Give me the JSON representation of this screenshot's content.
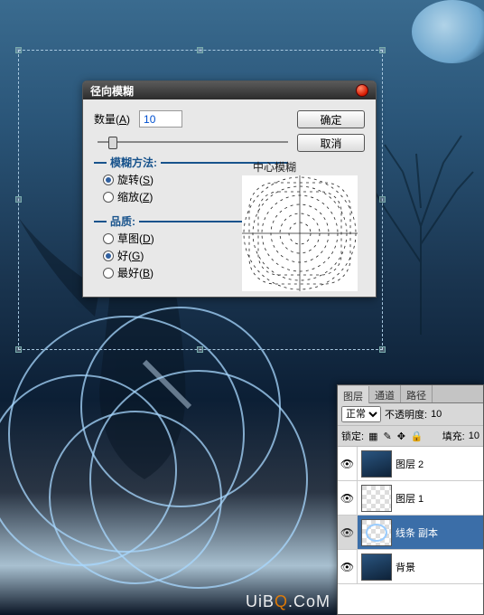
{
  "dialog": {
    "title": "径向模糊",
    "amount_label": "数量",
    "amount_key": "A",
    "amount_value": "10",
    "ok": "确定",
    "cancel": "取消",
    "method_group": "模糊方法:",
    "radio_spin": "旋转",
    "radio_spin_key": "S",
    "radio_zoom": "缩放",
    "radio_zoom_key": "Z",
    "quality_group": "品质:",
    "radio_draft": "草图",
    "radio_draft_key": "D",
    "radio_good": "好",
    "radio_good_key": "G",
    "radio_best": "最好",
    "radio_best_key": "B",
    "center_label": "中心模糊"
  },
  "layers_panel": {
    "tab_layers": "图层",
    "tab_channels": "通道",
    "tab_paths": "路径",
    "blend_mode": "正常",
    "opacity_label": "不透明度:",
    "opacity_value": "10",
    "lock_label": "锁定:",
    "fill_label": "填充:",
    "fill_value": "10",
    "layers": [
      {
        "name": "图层 2",
        "visible": true,
        "thumb": "blue",
        "active": false
      },
      {
        "name": "图层 1",
        "visible": true,
        "thumb": "checker",
        "active": false
      },
      {
        "name": "线条 副本",
        "visible": true,
        "thumb": "line",
        "active": true
      },
      {
        "name": "背景",
        "visible": true,
        "thumb": "blue",
        "active": false
      }
    ]
  },
  "watermark": {
    "text_pre": "UiB",
    "text_o": "Q",
    "text_post": ".CoM"
  }
}
